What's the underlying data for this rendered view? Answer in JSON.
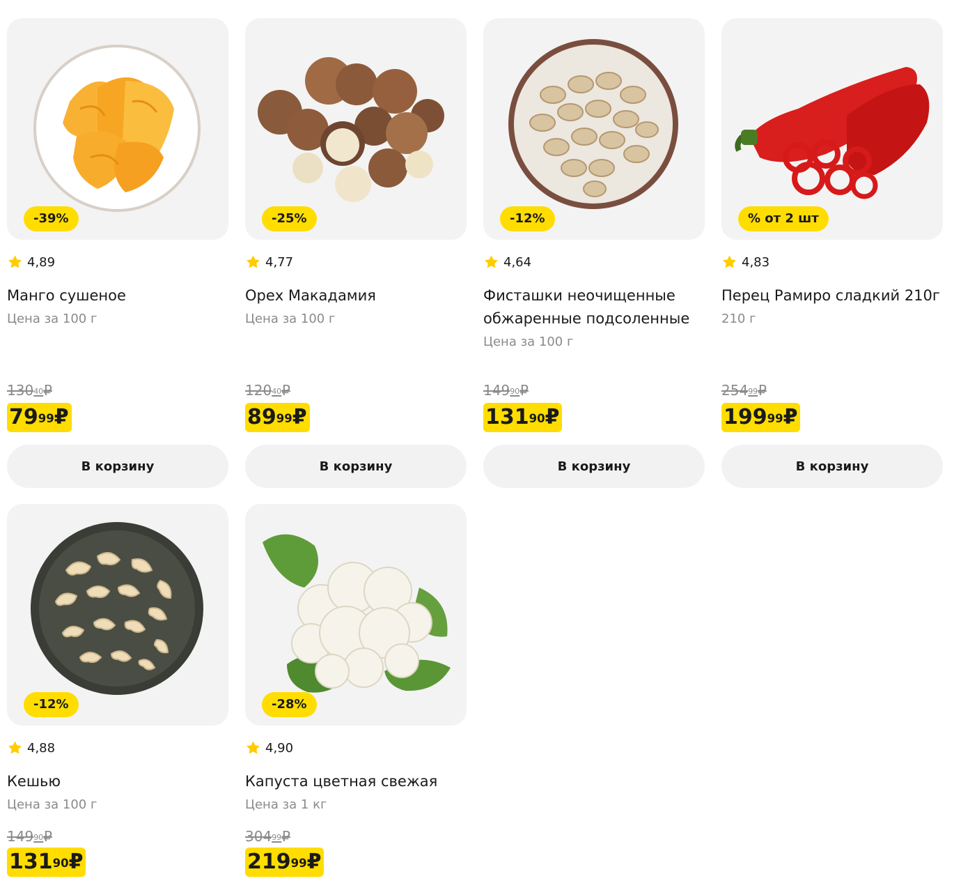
{
  "products": [
    {
      "badge": "-39%",
      "rating": "4,89",
      "title": "Манго сушеное",
      "unit": "Цена за 100 г",
      "old_int": "130",
      "old_frac": "40",
      "price_int": "79",
      "price_frac": "99",
      "button": "В корзину"
    },
    {
      "badge": "-25%",
      "rating": "4,77",
      "title": "Орех Макадамия",
      "unit": "Цена за 100 г",
      "old_int": "120",
      "old_frac": "40",
      "price_int": "89",
      "price_frac": "99",
      "button": "В корзину"
    },
    {
      "badge": "-12%",
      "rating": "4,64",
      "title": "Фисташки неочищенные обжаренные подсоленные",
      "unit": "Цена за 100 г",
      "old_int": "149",
      "old_frac": "90",
      "price_int": "131",
      "price_frac": "90",
      "button": "В корзину"
    },
    {
      "badge": "% от 2 шт",
      "rating": "4,83",
      "title": "Перец Рамиро сладкий 210г",
      "unit": "210 г",
      "old_int": "254",
      "old_frac": "99",
      "price_int": "199",
      "price_frac": "99",
      "button": "В корзину"
    },
    {
      "badge": "-12%",
      "rating": "4,88",
      "title": "Кешью",
      "unit": "Цена за 100 г",
      "old_int": "149",
      "old_frac": "90",
      "price_int": "131",
      "price_frac": "90"
    },
    {
      "badge": "-28%",
      "rating": "4,90",
      "title": "Капуста цветная свежая",
      "unit": "Цена за 1 кг",
      "old_int": "304",
      "old_frac": "99",
      "price_int": "219",
      "price_frac": "99"
    }
  ],
  "currency": "₽",
  "colors": {
    "accent": "#ffdd00",
    "card_bg": "#f3f3f3",
    "muted": "#8a8a8a"
  },
  "icons": {
    "rating": "star-icon"
  }
}
